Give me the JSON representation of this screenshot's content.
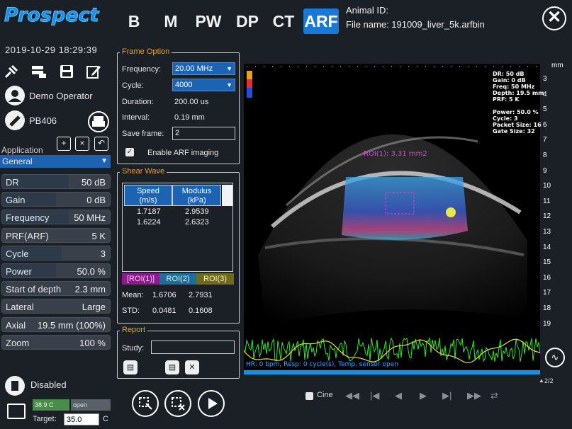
{
  "app": {
    "logo": "Prospect"
  },
  "modes": [
    {
      "label": "B",
      "active": false
    },
    {
      "label": "M",
      "active": false
    },
    {
      "label": "PW",
      "active": false
    },
    {
      "label": "DP",
      "active": false
    },
    {
      "label": "CT",
      "active": false
    },
    {
      "label": "ARF",
      "active": true
    }
  ],
  "header": {
    "animal_id": "Animal ID:",
    "file_name": "File name:  191009_liver_5k.arfbin",
    "close": "✕"
  },
  "left": {
    "datetime": "2019-10-29  18:29:39",
    "operator": "Demo Operator",
    "probe": "PB406",
    "application_label": "Application",
    "application_value": "General",
    "params": [
      {
        "label": "DR",
        "value": "50 dB",
        "fill": 0.62
      },
      {
        "label": "Gain",
        "value": "0 dB",
        "fill": 0.5
      },
      {
        "label": "Frequency",
        "value": "50 MHz",
        "fill": 0.62
      },
      {
        "label": "PRF(ARF)",
        "value": "5 K",
        "fill": 0.0
      },
      {
        "label": "Cycle",
        "value": "3",
        "fill": 0.55
      },
      {
        "label": "Power",
        "value": "50.0 %",
        "fill": 0.5
      },
      {
        "label": "Start of depth",
        "value": "2.3 mm",
        "fill": 0.03
      },
      {
        "label": "Lateral",
        "value": "Large",
        "fill": 0.0
      },
      {
        "label": "Axial",
        "value": "19.5 mm (100%)",
        "fill": 0.0
      },
      {
        "label": "Zoom",
        "value": "100 %",
        "fill": 0.0
      }
    ],
    "disabled": "Disabled",
    "temp": "38.9 C",
    "open": "open",
    "target_label": "Target:",
    "target_value": "35.0",
    "target_unit": "C"
  },
  "frame_option": {
    "title": "Frame Option",
    "frequency_label": "Frequency:",
    "frequency_value": "20.00 MHz",
    "cycle_label": "Cycle:",
    "cycle_value": "4000",
    "duration_label": "Duration:",
    "duration_value": "200.00 us",
    "interval_label": "Interval:",
    "interval_value": "0.19 mm",
    "save_frame_label": "Save frame:",
    "save_frame_value": "2",
    "enable_arf_label": "Enable ARF imaging"
  },
  "shear_wave": {
    "title": "Shear Wave",
    "col_speed": "Speed\n(m/s)",
    "col_modulus": "Modulus\n(kPa)",
    "rows": [
      {
        "speed": "1.7187",
        "modulus": "2.9539"
      },
      {
        "speed": "1.6224",
        "modulus": "2.6323"
      }
    ],
    "rois": [
      "[ROI(1)]",
      "ROI(2)",
      "ROI(3)"
    ],
    "mean_label": "Mean:",
    "mean_speed": "1.6706",
    "mean_modulus": "2.7931",
    "std_label": "STD:",
    "std_speed": "0.0481",
    "std_modulus": "0.1608"
  },
  "report": {
    "title": "Report",
    "study_label": "Study:",
    "study_value": ""
  },
  "image": {
    "overlay": [
      "DR: 50 dB",
      "Gain: 0 dB",
      "Freq: 50 MHz",
      "Depth: 19.5 mm",
      "PRF: 5 K",
      "",
      "Power: 50.0 %",
      "Cycle: 3",
      "Packet Size: 16",
      "Gate Size: 32"
    ],
    "roi_label": "ROI(1): 3.31 mm2",
    "mm_label": "mm",
    "ticks": [
      "3",
      "4",
      "5",
      "6",
      "7",
      "8",
      "9",
      "10",
      "11",
      "12",
      "13",
      "14",
      "15",
      "16",
      "17",
      "18",
      "19"
    ],
    "status": "HR: 0 bpm, Resp: 0 cycle(s), Temp. sensor open",
    "page": "2/2"
  },
  "playback": {
    "cine_label": "Cine"
  }
}
